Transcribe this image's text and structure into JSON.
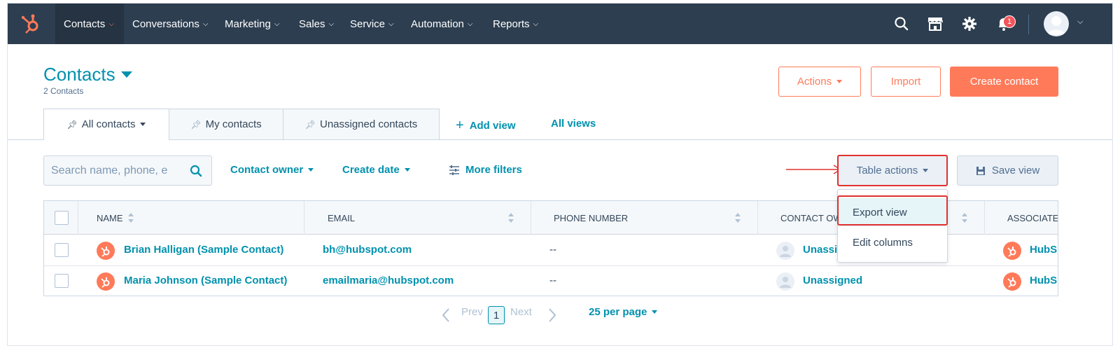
{
  "nav": {
    "items": [
      {
        "label": "Contacts",
        "active": true
      },
      {
        "label": "Conversations"
      },
      {
        "label": "Marketing"
      },
      {
        "label": "Sales"
      },
      {
        "label": "Service"
      },
      {
        "label": "Automation"
      },
      {
        "label": "Reports"
      }
    ],
    "notification_count": "1",
    "icons": [
      "search-icon",
      "marketplace-icon",
      "settings-gear-icon",
      "notifications-bell-icon",
      "user-avatar"
    ]
  },
  "header": {
    "title": "Contacts",
    "count_label": "2 Contacts",
    "actions_label": "Actions",
    "import_label": "Import",
    "create_label": "Create contact"
  },
  "views": {
    "tabs": [
      {
        "label": "All contacts",
        "active": true
      },
      {
        "label": "My contacts"
      },
      {
        "label": "Unassigned contacts"
      }
    ],
    "add_view_label": "Add view",
    "all_views_label": "All views"
  },
  "filters": {
    "search_placeholder": "Search name, phone, e",
    "contact_owner_label": "Contact owner",
    "create_date_label": "Create date",
    "more_filters_label": "More filters",
    "table_actions_label": "Table actions",
    "save_view_label": "Save view"
  },
  "dropdown": {
    "items": [
      "Export view",
      "Edit columns"
    ]
  },
  "table": {
    "columns": [
      "NAME",
      "EMAIL",
      "PHONE NUMBER",
      "CONTACT OW",
      "ASSOCIATEI"
    ],
    "rows": [
      {
        "name": "Brian Halligan (Sample Contact)",
        "email": "bh@hubspot.com",
        "phone": "--",
        "owner": "Unassig",
        "company": "HubS"
      },
      {
        "name": "Maria Johnson (Sample Contact)",
        "email": "emailmaria@hubspot.com",
        "phone": "--",
        "owner": "Unassigned",
        "company": "HubS"
      }
    ]
  },
  "pagination": {
    "prev_label": "Prev",
    "current_page": "1",
    "next_label": "Next",
    "per_page_label": "25 per page"
  },
  "colors": {
    "nav_bg": "#2d3e50",
    "accent": "#ff7a59",
    "link": "#0091ae",
    "highlight": "#e0312f"
  }
}
